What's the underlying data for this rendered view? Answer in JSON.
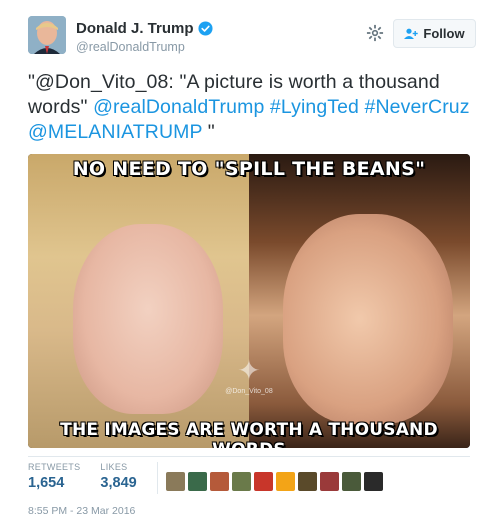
{
  "user": {
    "display_name": "Donald J. Trump",
    "handle": "@realDonaldTrump",
    "follow_label": "Follow"
  },
  "tweet": {
    "text_parts": [
      {
        "text": "\"@Don_Vito_08: \"A picture is worth a thousand words\" ",
        "link": false
      },
      {
        "text": "@realDonaldTrump",
        "link": true
      },
      {
        "text": "  ",
        "link": false
      },
      {
        "text": "#LyingTed",
        "link": true
      },
      {
        "text": " ",
        "link": false
      },
      {
        "text": "#NeverCruz",
        "link": true
      },
      {
        "text": "  ",
        "link": false
      },
      {
        "text": "@MELANIATRUMP",
        "link": true
      },
      {
        "text": " \"",
        "link": false
      }
    ]
  },
  "media": {
    "top_caption": "NO NEED TO \"SPILL THE BEANS\"",
    "bottom_caption": "THE IMAGES ARE WORTH A THOUSAND WORDS",
    "watermark": "@Don_Vito_08"
  },
  "stats": {
    "retweets_label": "RETWEETS",
    "retweets_value": "1,654",
    "likes_label": "LIKES",
    "likes_value": "3,849"
  },
  "liker_colors": [
    "#8a7a5a",
    "#3a6a4a",
    "#b55a3a",
    "#6a7a4a",
    "#c8362a",
    "#f3a417",
    "#5a4a2a",
    "#9a3a3a",
    "#4a5a3a",
    "#2a2a2a"
  ],
  "timestamp": "8:55 PM - 23 Mar 2016",
  "colors": {
    "link": "#1b95e0",
    "stat_value": "#2a6491",
    "muted": "#8899a6",
    "verified": "#1da1f2"
  }
}
